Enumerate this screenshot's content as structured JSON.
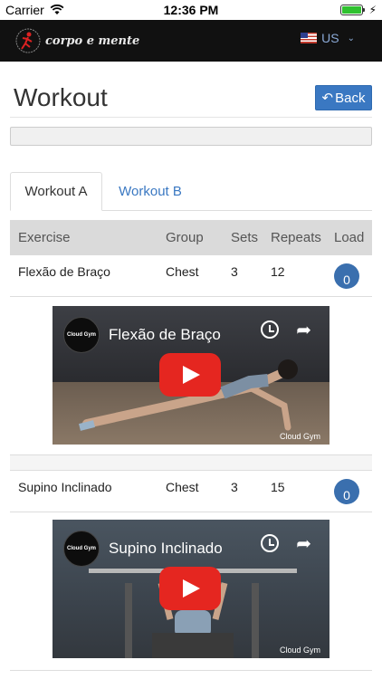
{
  "statusbar": {
    "carrier": "Carrier",
    "time": "12:36 PM"
  },
  "navbar": {
    "brand": "corpo e mente",
    "language": "US"
  },
  "page": {
    "title": "Workout",
    "back_label": "Back"
  },
  "tabs": [
    {
      "label": "Workout A",
      "active": true
    },
    {
      "label": "Workout B",
      "active": false
    }
  ],
  "table": {
    "headers": {
      "exercise": "Exercise",
      "group": "Group",
      "sets": "Sets",
      "repeats": "Repeats",
      "load": "Load"
    },
    "rows": [
      {
        "exercise": "Flexão de Braço",
        "group": "Chest",
        "sets": "3",
        "repeats": "12",
        "load": "0",
        "video": {
          "title": "Flexão de Braço",
          "channel": "Cloud Gym"
        }
      },
      {
        "exercise": "Supino Inclinado",
        "group": "Chest",
        "sets": "3",
        "repeats": "15",
        "load": "0",
        "video": {
          "title": "Supino Inclinado",
          "channel": "Cloud Gym"
        }
      }
    ]
  },
  "colors": {
    "accent": "#3a78c2",
    "badge": "#3a6fae",
    "play": "#e52620",
    "navbar": "#111111"
  }
}
